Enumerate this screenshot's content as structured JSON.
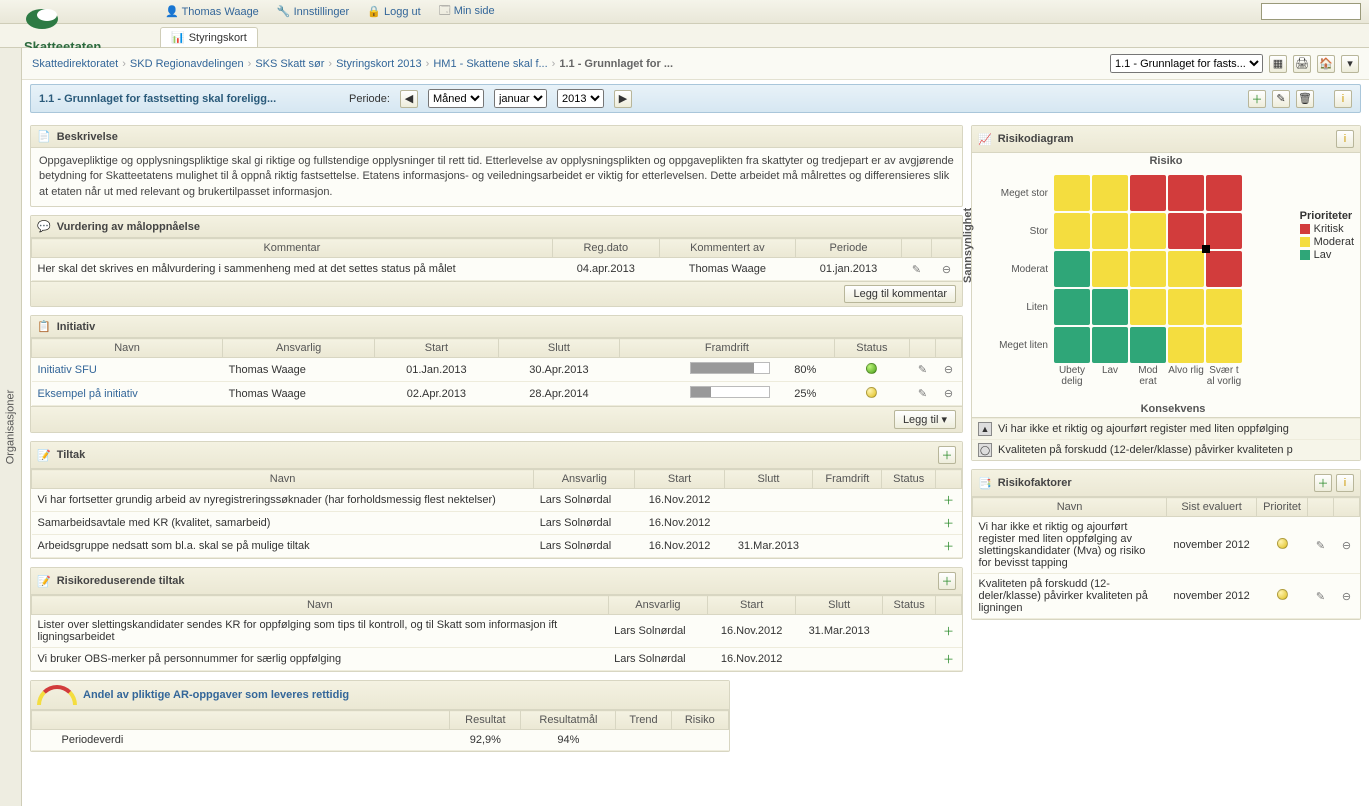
{
  "top": {
    "user": "Thomas Waage",
    "settings": "Innstillinger",
    "logout": "Logg ut",
    "mypage": "Min side"
  },
  "brand": "Skatteetaten",
  "tab": "Styringskort",
  "sidebar_label": "Organisasjoner",
  "breadcrumb": [
    "Skattedirektoratet",
    "SKD Regionavdelingen",
    "SKS Skatt sør",
    "Styringskort 2013",
    "HM1 - Skattene skal f...",
    "1.1 - Grunnlaget for ..."
  ],
  "bc_select": "1.1 - Grunnlaget for fasts...",
  "period_bar": {
    "title": "1.1 - Grunnlaget for fastsetting skal foreligg...",
    "label": "Periode:",
    "unit": "Måned",
    "month": "januar",
    "year": "2013"
  },
  "beskrivelse": {
    "title": "Beskrivelse",
    "text": "Oppgavepliktige og opplysningspliktige skal gi riktige og fullstendige opplysninger til rett tid. Etterlevelse av opplysningsplikten og oppgaveplikten fra skattyter og tredjepart er av avgjørende betydning for Skatteetatens mulighet til å oppnå riktig fastsettelse. Etatens informasjons- og veiledningsarbeidet er viktig for etterlevelsen. Dette arbeidet må målrettes og differensieres slik at etaten når ut med relevant og brukertilpasset informasjon."
  },
  "vurdering": {
    "title": "Vurdering av måloppnåelse",
    "cols": {
      "c1": "Kommentar",
      "c2": "Reg.dato",
      "c3": "Kommentert av",
      "c4": "Periode"
    },
    "row": {
      "text": "Her skal det skrives en målvurdering i sammenheng med at det settes status på målet",
      "dt": "04.apr.2013",
      "by": "Thomas Waage",
      "per": "01.jan.2013"
    },
    "add": "Legg til kommentar"
  },
  "initiativ": {
    "title": "Initiativ",
    "cols": {
      "c1": "Navn",
      "c2": "Ansvarlig",
      "c3": "Start",
      "c4": "Slutt",
      "c5": "Framdrift",
      "c6": "Status"
    },
    "rows": [
      {
        "n": "Initiativ SFU",
        "a": "Thomas Waage",
        "s": "01.Jan.2013",
        "e": "30.Apr.2013",
        "p": 80,
        "pl": "80%",
        "st": "green"
      },
      {
        "n": "Eksempel på initiativ",
        "a": "Thomas Waage",
        "s": "02.Apr.2013",
        "e": "28.Apr.2014",
        "p": 25,
        "pl": "25%",
        "st": "yellow"
      }
    ],
    "add": "Legg til"
  },
  "tiltak": {
    "title": "Tiltak",
    "cols": {
      "c1": "Navn",
      "c2": "Ansvarlig",
      "c3": "Start",
      "c4": "Slutt",
      "c5": "Framdrift",
      "c6": "Status"
    },
    "rows": [
      {
        "n": "Vi har fortsetter grundig arbeid av nyregistreringssøknader (har forholdsmessig flest nektelser)",
        "a": "Lars Solnørdal",
        "s": "16.Nov.2012",
        "e": "",
        "p": "",
        "st": ""
      },
      {
        "n": "Samarbeidsavtale med KR (kvalitet, samarbeid)",
        "a": "Lars Solnørdal",
        "s": "16.Nov.2012",
        "e": "",
        "p": "",
        "st": ""
      },
      {
        "n": "Arbeidsgruppe nedsatt som bl.a. skal se på mulige tiltak",
        "a": "Lars Solnørdal",
        "s": "16.Nov.2012",
        "e": "31.Mar.2013",
        "p": "",
        "st": ""
      }
    ]
  },
  "risikored": {
    "title": "Risikoreduserende tiltak",
    "cols": {
      "c1": "Navn",
      "c2": "Ansvarlig",
      "c3": "Start",
      "c4": "Slutt",
      "c5": "Status"
    },
    "rows": [
      {
        "n": "Lister over slettingskandidater sendes KR for oppfølging som tips til kontroll, og til Skatt som informasjon ift ligningsarbeidet",
        "a": "Lars Solnørdal",
        "s": "16.Nov.2012",
        "e": "31.Mar.2013"
      },
      {
        "n": "Vi bruker OBS-merker på personnummer for særlig oppfølging",
        "a": "Lars Solnørdal",
        "s": "16.Nov.2012",
        "e": ""
      }
    ]
  },
  "kpi": {
    "title": "Andel av pliktige AR-oppgaver som leveres rettidig",
    "cols": {
      "c1": "Resultat",
      "c2": "Resultatmål",
      "c3": "Trend",
      "c4": "Risiko"
    },
    "row_label": "Periodeverdi",
    "r": "92,9%",
    "m": "94%"
  },
  "risk": {
    "title": "Risikodiagram",
    "top": "Risiko",
    "ylabel": "Sannsynlighet",
    "xlabel": "Konsekvens",
    "rows": [
      "Meget stor",
      "Stor",
      "Moderat",
      "Liten",
      "Meget liten"
    ],
    "cols": [
      "Ubety delig",
      "Lav",
      "Mod erat",
      "Alvo rlig",
      "Svær t al vorlig"
    ],
    "legend_title": "Prioriteter",
    "legend": [
      "Kritisk",
      "Moderat",
      "Lav"
    ],
    "notes": [
      "Vi har ikke et riktig og ajourført register med liten oppfølging",
      "Kvaliteten på forskudd (12-deler/klasse) påvirker kvaliteten p"
    ]
  },
  "riskfact": {
    "title": "Risikofaktorer",
    "cols": {
      "c1": "Navn",
      "c2": "Sist evaluert",
      "c3": "Prioritet"
    },
    "rows": [
      {
        "n": "Vi har ikke et riktig og ajourført register med liten oppfølging av slettingskandidater (Mva) og risiko for bevisst tapping",
        "d": "november 2012"
      },
      {
        "n": "Kvaliteten på forskudd (12-deler/klasse) påvirker kvaliteten på ligningen",
        "d": "november 2012"
      }
    ]
  },
  "chart_data": {
    "type": "heatmap",
    "title": "Risiko",
    "xlabel": "Konsekvens",
    "ylabel": "Sannsynlighet",
    "x_categories": [
      "Ubetydelig",
      "Lav",
      "Moderat",
      "Alvorlig",
      "Svært alvorlig"
    ],
    "y_categories": [
      "Meget stor",
      "Stor",
      "Moderat",
      "Liten",
      "Meget liten"
    ],
    "color_scale": {
      "Lav": "#2fa678",
      "Moderat": "#f4dd3f",
      "Kritisk": "#d23c3c"
    },
    "grid": [
      [
        "Moderat",
        "Moderat",
        "Kritisk",
        "Kritisk",
        "Kritisk"
      ],
      [
        "Moderat",
        "Moderat",
        "Moderat",
        "Kritisk",
        "Kritisk"
      ],
      [
        "Lav",
        "Moderat",
        "Moderat",
        "Moderat",
        "Kritisk"
      ],
      [
        "Lav",
        "Lav",
        "Moderat",
        "Moderat",
        "Moderat"
      ],
      [
        "Lav",
        "Lav",
        "Lav",
        "Moderat",
        "Moderat"
      ]
    ],
    "points": [
      {
        "x": "Svært alvorlig",
        "y": "Stor",
        "label": "marker"
      }
    ]
  }
}
